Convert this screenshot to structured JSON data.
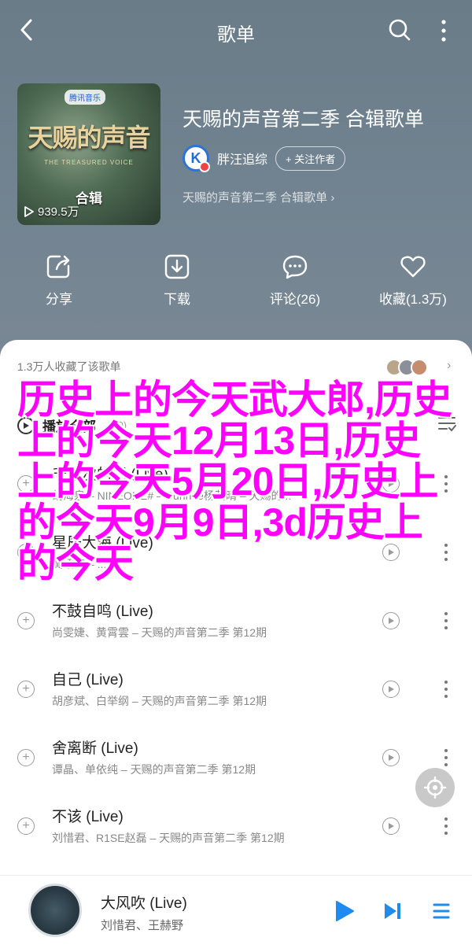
{
  "header": {
    "title": "歌单"
  },
  "cover": {
    "badge": "腾讯音乐",
    "brand": "天赐的声音",
    "subtitle": "THE TREASURED VOICE",
    "tag": "合辑",
    "plays": "939.5万"
  },
  "playlist": {
    "title": "天赐的声音第二季 合辑歌单",
    "author": "胖汪追综",
    "author_avatar_letter": "K",
    "follow_label": "+ 关注作者",
    "description": "天赐的声音第二季 合辑歌单 ›"
  },
  "actions": [
    {
      "label": "分享",
      "icon": "share-icon"
    },
    {
      "label": "下载",
      "icon": "download-icon"
    },
    {
      "label": "评论(26)",
      "icon": "comment-icon"
    },
    {
      "label": "收藏(1.3万)",
      "icon": "heart-icon"
    }
  ],
  "favorites": {
    "text": "1.3万人收藏了该歌单"
  },
  "play_all": {
    "label": "播放全部",
    "count": "(90)"
  },
  "songs": [
    {
      "name": "千万次的问 (Live)",
      "meta": "胡海泉 – NINEONE# – Sunnee杨芸晴 – 天赐的..."
    },
    {
      "name": "星辰大海 (Live)",
      "meta": "黄绍鸿 – ..."
    },
    {
      "name": "不鼓自鸣 (Live)",
      "meta": "尚雯婕、黄霄雲 – 天赐的声音第二季 第12期"
    },
    {
      "name": "自己 (Live)",
      "meta": "胡彦斌、白举纲 – 天赐的声音第二季 第12期"
    },
    {
      "name": "舍离断 (Live)",
      "meta": "谭晶、单依纯 – 天赐的声音第二季 第12期"
    },
    {
      "name": "不该 (Live)",
      "meta": "刘惜君、R1SE赵磊 – 天赐的声音第二季 第12期"
    }
  ],
  "overlay": {
    "text": "历史上的今天武大郎,历史上的今天12月13日,历史上的今天5月20日,历史上的今天9月9日,3d历史上的今天"
  },
  "player": {
    "song": "大风吹 (Live)",
    "artist": "刘惜君、王赫野"
  },
  "colors": {
    "accent": "#1f8bf0",
    "overlay": "#ff00ff"
  }
}
